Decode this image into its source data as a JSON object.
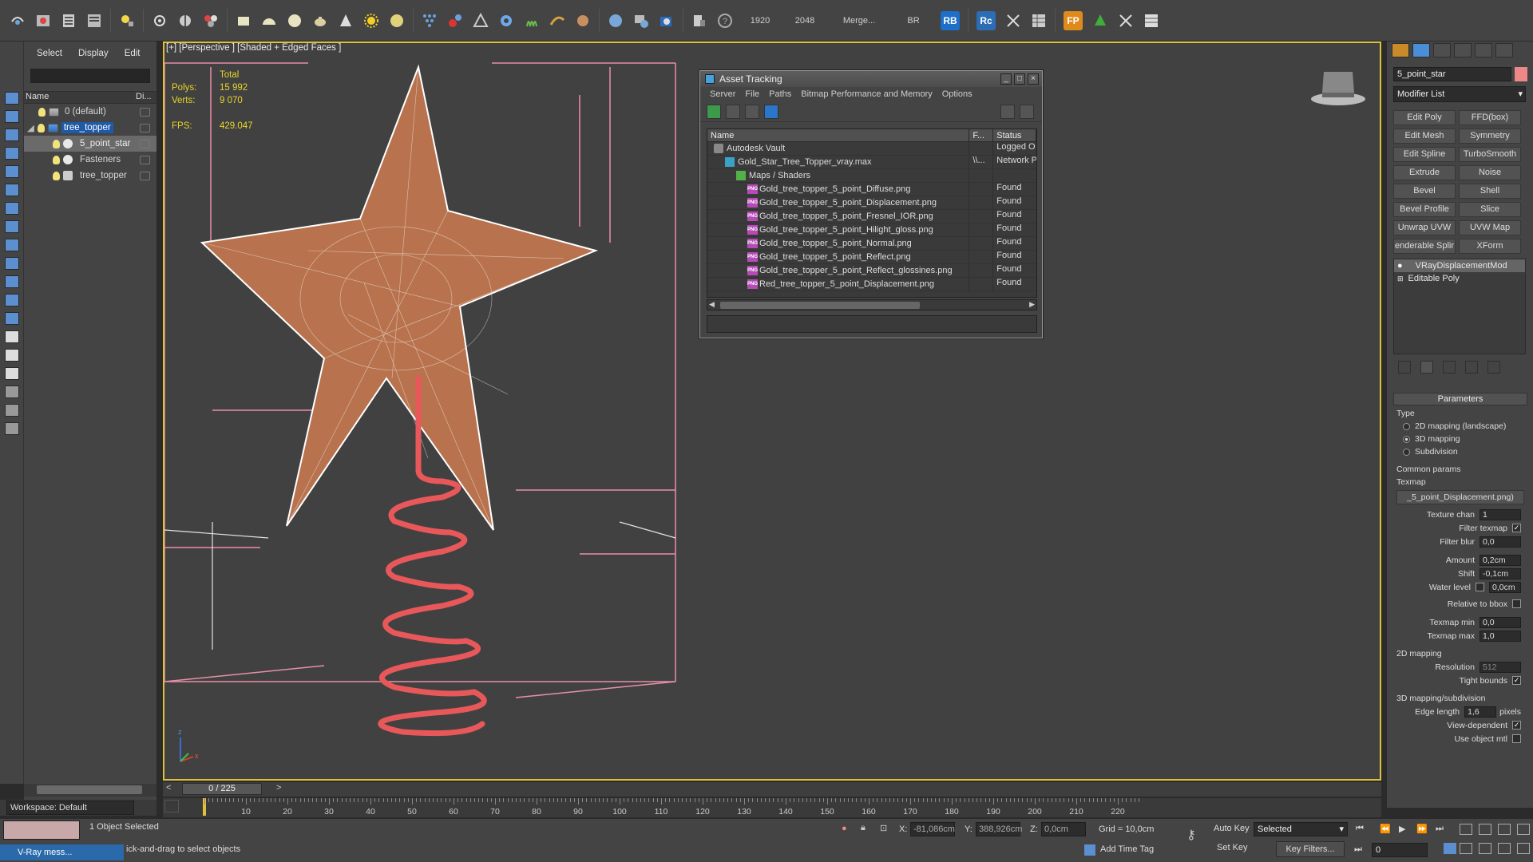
{
  "toolbar": {
    "render_width": "1920",
    "render_height": "2048",
    "merge_label": "Merge...",
    "br_label": "BR",
    "rb_label": "RB",
    "rc_label": "Rc",
    "fp_label": "FP"
  },
  "explorer": {
    "menu": [
      "Select",
      "Display",
      "Edit"
    ],
    "columns": {
      "name": "Name",
      "display": "Di..."
    },
    "rows": [
      {
        "label": "0 (default)",
        "level": 1
      },
      {
        "label": "tree_topper",
        "level": 1
      },
      {
        "label": "5_point_star",
        "level": 2
      },
      {
        "label": "Fasteners",
        "level": 2
      },
      {
        "label": "tree_topper",
        "level": 2
      }
    ]
  },
  "workspace": "Workspace: Default",
  "viewport": {
    "label": "[+] [Perspective ] [Shaded + Edged Faces ]",
    "stats": {
      "total_label": "Total",
      "polys_label": "Polys:",
      "polys_value": "15 992",
      "verts_label": "Verts:",
      "verts_value": "9 070",
      "fps_label": "FPS:",
      "fps_value": "429.047"
    },
    "star_color": "#b8734e",
    "spring_color": "#e8585a"
  },
  "asset_tracking": {
    "title": "Asset Tracking",
    "menu": [
      "Server",
      "File",
      "Paths",
      "Bitmap Performance and Memory",
      "Options"
    ],
    "columns": {
      "name": "Name",
      "f": "F...",
      "status": "Status"
    },
    "rows": [
      {
        "name": "Autodesk Vault",
        "f": "",
        "status": "Logged O",
        "indent": 1,
        "icon": "vault"
      },
      {
        "name": "Gold_Star_Tree_Topper_vray.max",
        "f": "\\\\...",
        "status": "Network P",
        "indent": 2,
        "icon": "max"
      },
      {
        "name": "Maps / Shaders",
        "f": "",
        "status": "",
        "indent": 3,
        "icon": "maps"
      },
      {
        "name": "Gold_tree_topper_5_point_Diffuse.png",
        "f": "",
        "status": "Found",
        "indent": 4,
        "icon": "png"
      },
      {
        "name": "Gold_tree_topper_5_point_Displacement.png",
        "f": "",
        "status": "Found",
        "indent": 4,
        "icon": "png"
      },
      {
        "name": "Gold_tree_topper_5_point_Fresnel_IOR.png",
        "f": "",
        "status": "Found",
        "indent": 4,
        "icon": "png"
      },
      {
        "name": "Gold_tree_topper_5_point_Hilight_gloss.png",
        "f": "",
        "status": "Found",
        "indent": 4,
        "icon": "png"
      },
      {
        "name": "Gold_tree_topper_5_point_Normal.png",
        "f": "",
        "status": "Found",
        "indent": 4,
        "icon": "png"
      },
      {
        "name": "Gold_tree_topper_5_point_Reflect.png",
        "f": "",
        "status": "Found",
        "indent": 4,
        "icon": "png"
      },
      {
        "name": "Gold_tree_topper_5_point_Reflect_glossines.png",
        "f": "",
        "status": "Found",
        "indent": 4,
        "icon": "png"
      },
      {
        "name": "Red_tree_topper_5_point_Displacement.png",
        "f": "",
        "status": "Found",
        "indent": 4,
        "icon": "png"
      }
    ]
  },
  "command_panel": {
    "object_name": "5_point_star",
    "modifier_list": "Modifier List",
    "modifier_buttons": [
      "Edit Poly",
      "FFD(box)",
      "Edit Mesh",
      "Symmetry",
      "Edit Spline",
      "TurboSmooth",
      "Extrude",
      "Noise",
      "Bevel",
      "Shell",
      "Bevel Profile",
      "Slice",
      "Unwrap UVW",
      "UVW Map",
      "enderable Splir",
      "XForm"
    ],
    "stack": [
      "VRayDisplacementMod",
      "Editable Poly"
    ],
    "parameters": {
      "rollout": "Parameters",
      "type_label": "Type",
      "type_options": [
        "2D mapping (landscape)",
        "3D mapping",
        "Subdivision"
      ],
      "common_label": "Common params",
      "texmap_label": "Texmap",
      "texmap_value": "_5_point_Displacement.png)",
      "texture_chan_label": "Texture chan",
      "texture_chan_value": "1",
      "filter_texmap_label": "Filter texmap",
      "filter_blur_label": "Filter blur",
      "filter_blur_value": "0,0",
      "amount_label": "Amount",
      "amount_value": "0,2cm",
      "shift_label": "Shift",
      "shift_value": "-0,1cm",
      "water_level_label": "Water level",
      "water_level_value": "0,0cm",
      "relative_bbox_label": "Relative to bbox",
      "texmap_min_label": "Texmap min",
      "texmap_min_value": "0,0",
      "texmap_max_label": "Texmap max",
      "texmap_max_value": "1,0",
      "mapping2d_label": "2D mapping",
      "resolution_label": "Resolution",
      "resolution_value": "512",
      "tight_bounds_label": "Tight bounds",
      "mapping3d_label": "3D mapping/subdivision",
      "edge_length_label": "Edge length",
      "edge_length_value": "1,6",
      "pixels_label": "pixels",
      "view_dependent_label": "View-dependent",
      "use_object_mtl_label": "Use object mtl"
    }
  },
  "timeline": {
    "slider": "0 / 225",
    "ticks": [
      "10",
      "20",
      "30",
      "40",
      "50",
      "60",
      "70",
      "80",
      "90",
      "100",
      "110",
      "120",
      "130",
      "140",
      "150",
      "160",
      "170",
      "180",
      "190",
      "200",
      "210",
      "220"
    ]
  },
  "status": {
    "selection": "1 Object Selected",
    "prompt": "ick-and-drag to select objects",
    "vray_msg": "V-Ray mess...",
    "x_label": "X:",
    "x_value": "-81,086cm",
    "y_label": "Y:",
    "y_value": "388,926cm",
    "z_label": "Z:",
    "z_value": "0,0cm",
    "grid": "Grid = 10,0cm",
    "add_time_tag": "Add Time Tag",
    "auto_key": "Auto Key",
    "set_key": "Set Key",
    "selected": "Selected",
    "key_filters": "Key Filters...",
    "frame": "0"
  }
}
